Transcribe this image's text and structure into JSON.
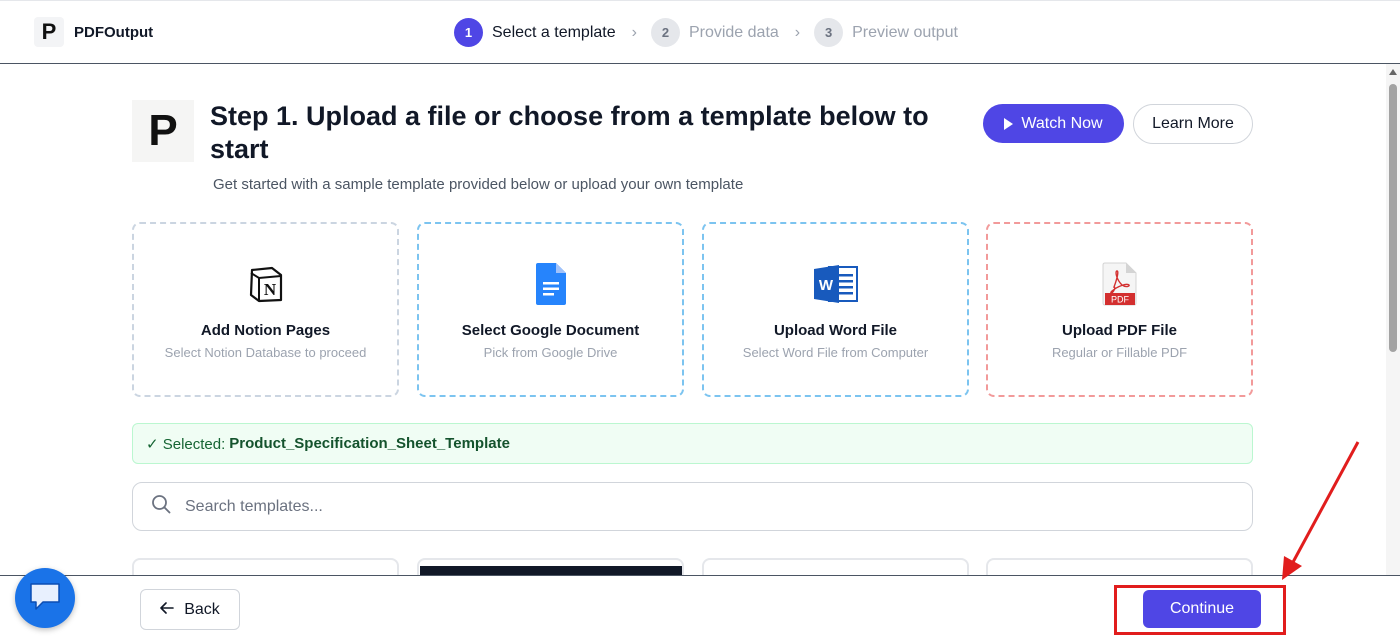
{
  "app": {
    "logo_letter": "P",
    "name": "PDFOutput"
  },
  "stepper": {
    "steps": [
      {
        "num": "1",
        "label": "Select a template",
        "active": true
      },
      {
        "num": "2",
        "label": "Provide data",
        "active": false
      },
      {
        "num": "3",
        "label": "Preview output",
        "active": false
      }
    ]
  },
  "hero": {
    "logo_letter": "P",
    "title": "Step 1. Upload a file or choose from a template below to start",
    "subtitle": "Get started with a sample template provided below or upload your own template",
    "watch_label": "Watch Now",
    "learn_label": "Learn More"
  },
  "cards": [
    {
      "title": "Add Notion Pages",
      "subtitle": "Select Notion Database to proceed",
      "icon": "notion-icon"
    },
    {
      "title": "Select Google Document",
      "subtitle": "Pick from Google Drive",
      "icon": "google-docs-icon"
    },
    {
      "title": "Upload Word File",
      "subtitle": "Select Word File from Computer",
      "icon": "word-icon"
    },
    {
      "title": "Upload PDF File",
      "subtitle": "Regular or Fillable PDF",
      "icon": "pdf-icon"
    }
  ],
  "pdf_badge": "PDF",
  "word_letter": "W",
  "notion_letter": "N",
  "selected": {
    "prefix": "✓ Selected:",
    "value": "Product_Specification_Sheet_Template"
  },
  "search": {
    "placeholder": "Search templates..."
  },
  "footer": {
    "back_label": "Back",
    "continue_label": "Continue"
  },
  "colors": {
    "accent": "#4f46e5",
    "annotation": "#e11d1d",
    "success_bg": "#f0fdf4"
  }
}
